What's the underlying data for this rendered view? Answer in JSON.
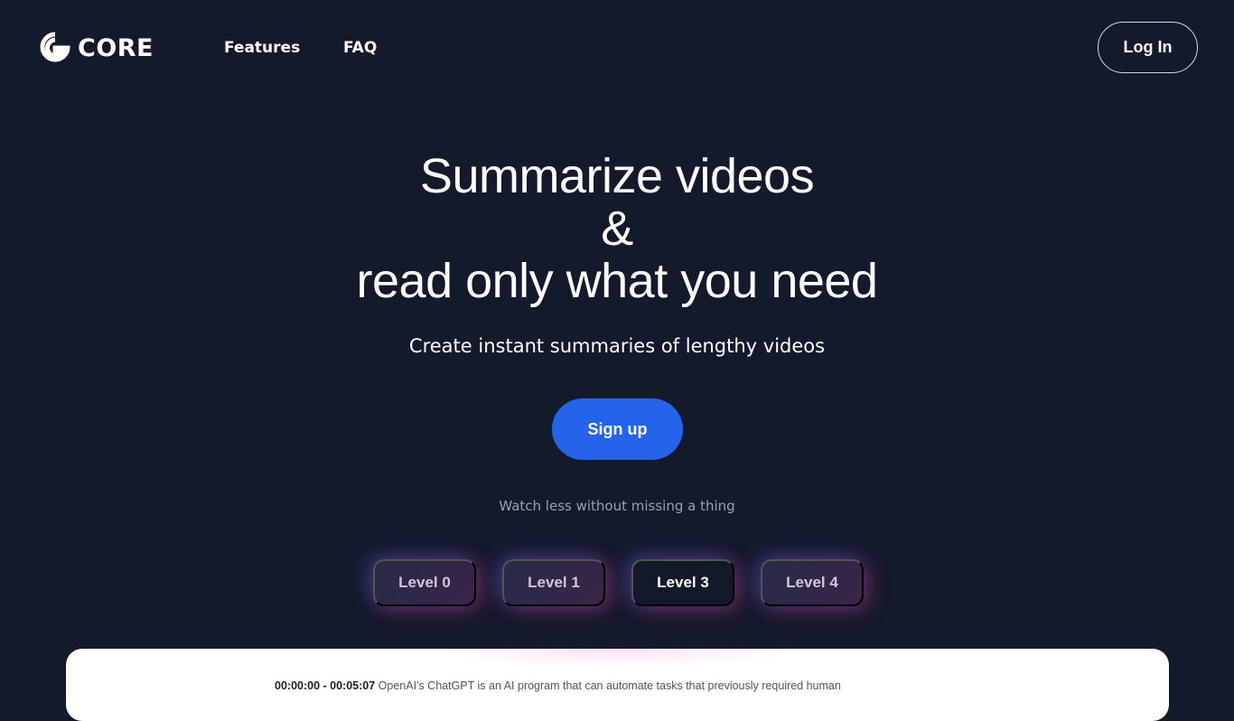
{
  "nav": {
    "logo_text": "CORE",
    "links": [
      {
        "label": "Features"
      },
      {
        "label": "FAQ"
      }
    ],
    "login_label": "Log In"
  },
  "hero": {
    "title_lines": [
      "Summarize videos",
      "&",
      "read only what you need"
    ],
    "subtitle": "Create instant summaries of lengthy videos",
    "signup_label": "Sign up",
    "tagline": "Watch less without missing a thing"
  },
  "levels": {
    "selected": "Level 3",
    "items": [
      {
        "label": "Level 0"
      },
      {
        "label": "Level 1"
      },
      {
        "label": "Level 3"
      },
      {
        "label": "Level 4"
      }
    ]
  },
  "preview": {
    "timestamp": "00:00:00 - 00:05:07",
    "text": "OpenAI's ChatGPT is an AI program that can automate tasks that previously required human"
  },
  "colors": {
    "background": "#131a2b",
    "accent": "#2563eb"
  }
}
